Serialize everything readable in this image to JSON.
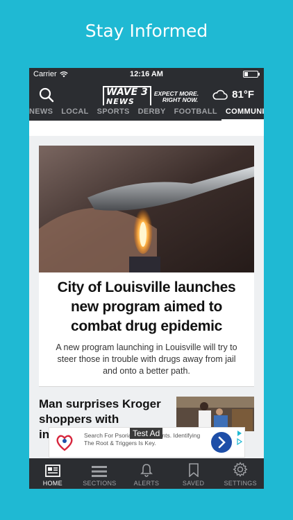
{
  "promo": {
    "title": "Stay Informed"
  },
  "status_bar": {
    "carrier": "Carrier",
    "time": "12:16 AM"
  },
  "header": {
    "logo_top": "WAVE 3",
    "logo_bottom": "NEWS",
    "tagline_line1": "EXPECT MORE.",
    "tagline_line2": "RIGHT NOW.",
    "temperature": "81°F"
  },
  "tabs": [
    "NEWS",
    "LOCAL",
    "SPORTS",
    "DERBY",
    "FOOTBALL",
    "COMMUNITY"
  ],
  "active_tab": "COMMUNITY",
  "lead_story": {
    "headline": "City of Louisville launches new program aimed to combat drug epidemic",
    "summary": "A new program launching in Louisville will try to steer those in trouble with drugs away from jail and onto a better path."
  },
  "second_story": {
    "title": "Man surprises Kroger shoppers with incredible"
  },
  "ad": {
    "label": "Test Ad",
    "text": "Search For Psoriasis Treatments. Identifying The Root & Triggers Is Key."
  },
  "tab_bar": [
    "HOME",
    "SECTIONS",
    "ALERTS",
    "SAVED",
    "SETTINGS"
  ],
  "colors": {
    "background": "#1fb9d3",
    "bar": "#2b2d31",
    "ad_button": "#1d4ea8"
  }
}
